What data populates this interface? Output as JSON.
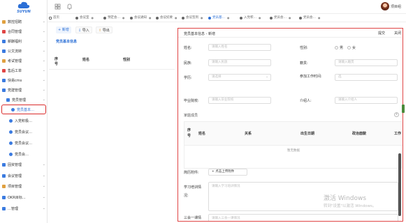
{
  "brand": {
    "name": "SUYUN"
  },
  "sidebar": {
    "items": [
      {
        "label": "数控招聘",
        "icon": "recruit-icon",
        "color": "#e0a040"
      },
      {
        "label": "合同管理",
        "icon": "contract-icon",
        "color": "#e04545"
      },
      {
        "label": "薪酬福利",
        "icon": "salary-icon",
        "color": "#3b7be0"
      },
      {
        "label": "公文流转",
        "icon": "document-flow-icon",
        "color": "#3b7be0"
      },
      {
        "label": "考试管理",
        "icon": "exam-icon",
        "color": "#e0a040"
      },
      {
        "label": "售后工单",
        "icon": "ticket-icon",
        "color": "#e04545"
      },
      {
        "label": "快易cms",
        "icon": "cms-icon",
        "color": "#3b7be0"
      },
      {
        "label": "党建管理",
        "icon": "party-icon",
        "color": "#3b7be0"
      },
      {
        "label": "党员管理",
        "icon": "member-icon",
        "color": "#3b7be0"
      },
      {
        "label": "党员基本…",
        "icon": "member-basic-icon",
        "color": "#3b7be0"
      },
      {
        "label": "入党积极…",
        "icon": "activist-icon",
        "color": "#3b7be0"
      },
      {
        "label": "党员会议…",
        "icon": "meeting-icon",
        "color": "#3b7be0"
      },
      {
        "label": "党员会议…",
        "icon": "meeting2-icon",
        "color": "#3b7be0"
      },
      {
        "label": "党员会…",
        "icon": "meeting3-icon",
        "color": "#3b7be0"
      },
      {
        "label": "固资管理",
        "icon": "asset-icon",
        "color": "#3b7be0"
      },
      {
        "label": "会议管理",
        "icon": "conference-icon",
        "color": "#3b7be0"
      },
      {
        "label": "项目管理",
        "icon": "project-icon",
        "color": "#e0a040"
      },
      {
        "label": "OKR目标…",
        "icon": "okr-icon",
        "color": "#3b7be0"
      },
      {
        "label": "…管理",
        "icon": "misc-icon",
        "color": "#3b7be0"
      }
    ]
  },
  "tabs": [
    {
      "label": "首页"
    },
    {
      "label": "会议室"
    },
    {
      "label": "预定会…"
    },
    {
      "label": "会议通知"
    },
    {
      "label": "会议纪要"
    },
    {
      "label": "会议签到"
    },
    {
      "label": "党员基…"
    },
    {
      "label": "入党积…"
    },
    {
      "label": "党员会…"
    },
    {
      "label": "党员会…"
    }
  ],
  "toolbar": {
    "add": "+ 新增",
    "import": "导入",
    "export": "导出"
  },
  "panel": {
    "title": "党员基本信息"
  },
  "list": {
    "col_no": "序号",
    "col_name": "姓名",
    "col_gender": "性别"
  },
  "modal": {
    "title": "党员基本信息 - 新增",
    "submit": "提交",
    "close": "关闭",
    "fields": {
      "name_label": "姓名:",
      "name_ph": "请输入姓名",
      "gender_label": "性别:",
      "male": "男",
      "female": "女",
      "nation_label": "民族:",
      "nation_ph": "请输入民族",
      "origin_label": "籍贯:",
      "origin_ph": "请输入籍贯",
      "edu_label": "学历:",
      "edu_ph": "请选择",
      "workdate_label": "参加工作时间:",
      "workdate_ph": "选",
      "school_label": "毕业院校:",
      "school_ph": "请输入毕业院校",
      "introducer_label": "介绍人:",
      "introducer_ph": "请输入介绍人"
    },
    "family": {
      "title": "家庭成员",
      "headers": [
        "序号",
        "姓名",
        "关系",
        "出生日期",
        "政治面貌",
        "工作"
      ],
      "empty": "暂无数据"
    },
    "attach_label": "简历附件:",
    "attach_btn": "+ 点击上传附件",
    "study_label": "学习培训情况:",
    "study_ph": "请输入学习培训情况",
    "lesson_label": "三会一课情",
    "lesson_ph": "请输入三会一课情况"
  },
  "watermark": {
    "line1": "激活 Windows",
    "line2": "转到\"设置\"以激活 Windows。"
  },
  "user": {
    "name": "项目组"
  }
}
